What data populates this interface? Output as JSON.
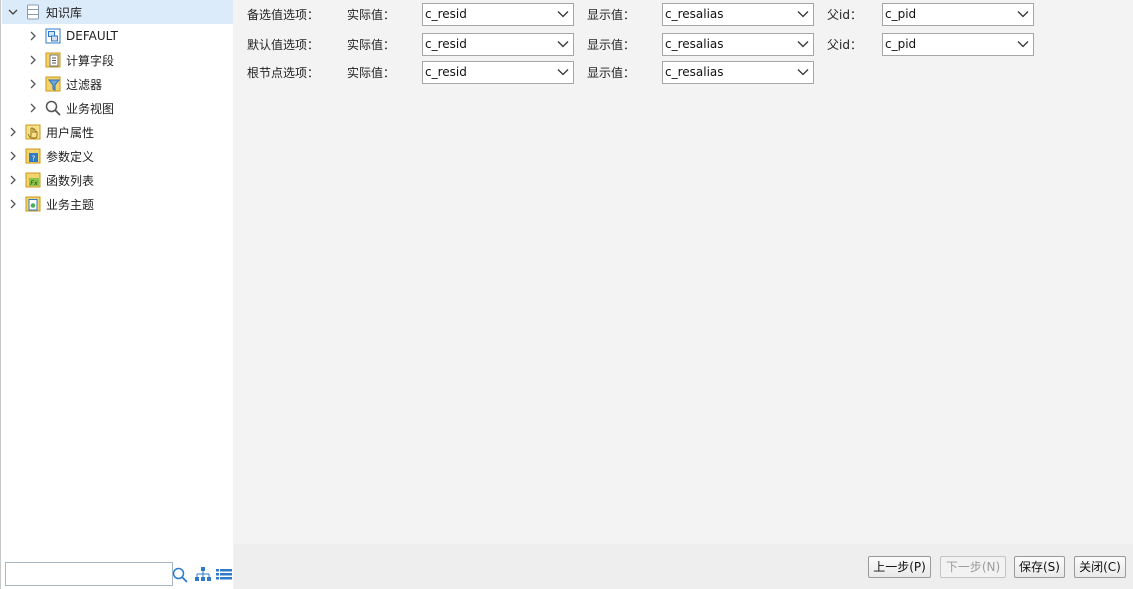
{
  "tree": {
    "root": {
      "label": "知识库",
      "icon": "database-icon",
      "expanded": true
    },
    "children": [
      {
        "label": "DEFAULT",
        "icon": "schema-icon"
      },
      {
        "label": "计算字段",
        "icon": "calculated-field-icon"
      },
      {
        "label": "过滤器",
        "icon": "filter-icon"
      },
      {
        "label": "业务视图",
        "icon": "magnifier-icon"
      }
    ],
    "top_level": [
      {
        "label": "用户属性",
        "icon": "hand-icon"
      },
      {
        "label": "参数定义",
        "icon": "parameter-icon"
      },
      {
        "label": "函数列表",
        "icon": "function-icon"
      },
      {
        "label": "业务主题",
        "icon": "business-theme-icon"
      }
    ]
  },
  "search": {
    "value": "",
    "placeholder": ""
  },
  "form": {
    "rows": [
      {
        "label": "备选值选项：",
        "actual_label": "实际值：",
        "actual_value": "c_resid",
        "display_label": "显示值：",
        "display_value": "c_resalias",
        "parent_label": "父id：",
        "parent_value": "c_pid"
      },
      {
        "label": "默认值选项：",
        "actual_label": "实际值：",
        "actual_value": "c_resid",
        "display_label": "显示值：",
        "display_value": "c_resalias",
        "parent_label": "父id：",
        "parent_value": "c_pid"
      },
      {
        "label": "根节点选项：",
        "actual_label": "实际值：",
        "actual_value": "c_resid",
        "display_label": "显示值：",
        "display_value": "c_resalias"
      }
    ]
  },
  "buttons": {
    "prev": "上一步(P)",
    "next": "下一步(N)",
    "save": "保存(S)",
    "close": "关闭(C)"
  },
  "colors": {
    "selected_row": "#dcebf9",
    "panel_bg": "#f3f3f3",
    "icon_blue": "#2f7bc8",
    "icon_yellow": "#e8c24a"
  }
}
